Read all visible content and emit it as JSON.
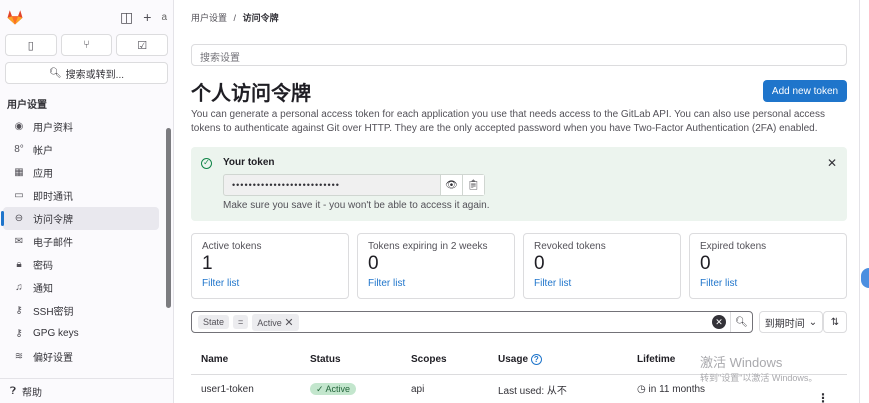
{
  "sidebar": {
    "avatar_alt": "a",
    "search_label": "搜索或转到...",
    "section_title": "用户设置",
    "items": [
      {
        "label": "用户资料",
        "icon": "profile-icon"
      },
      {
        "label": "帐户",
        "icon": "account-icon"
      },
      {
        "label": "应用",
        "icon": "applications-icon"
      },
      {
        "label": "即时通讯",
        "icon": "chat-icon"
      },
      {
        "label": "访问令牌",
        "icon": "token-icon",
        "active": true
      },
      {
        "label": "电子邮件",
        "icon": "mail-icon"
      },
      {
        "label": "密码",
        "icon": "lock-icon"
      },
      {
        "label": "通知",
        "icon": "bell-icon"
      },
      {
        "label": "SSH密钥",
        "icon": "key-icon"
      },
      {
        "label": "GPG keys",
        "icon": "key-icon"
      },
      {
        "label": "偏好设置",
        "icon": "preferences-icon"
      }
    ],
    "help_label": "帮助"
  },
  "breadcrumb": {
    "parent": "用户设置",
    "sep": "/",
    "current": "访问令牌"
  },
  "search_settings_placeholder": "搜索设置",
  "page": {
    "title": "个人访问令牌",
    "add_button": "Add new token",
    "description": "You can generate a personal access token for each application you use that needs access to the GitLab API. You can also use personal access tokens to authenticate against Git over HTTP. They are the only accepted password when you have Two-Factor Authentication (2FA) enabled."
  },
  "alert": {
    "title": "Your token",
    "token_masked": "••••••••••••••••••••••••••",
    "note": "Make sure you save it - you won't be able to access it again."
  },
  "stats": [
    {
      "label": "Active tokens",
      "value": "1",
      "link": "Filter list"
    },
    {
      "label": "Tokens expiring in 2 weeks",
      "value": "0",
      "link": "Filter list"
    },
    {
      "label": "Revoked tokens",
      "value": "0",
      "link": "Filter list"
    },
    {
      "label": "Expired tokens",
      "value": "0",
      "link": "Filter list"
    }
  ],
  "filter": {
    "field": "State",
    "op": "=",
    "value": "Active"
  },
  "sort": {
    "label": "到期时间"
  },
  "table": {
    "headers": [
      "Name",
      "Status",
      "Scopes",
      "Usage",
      "Lifetime"
    ],
    "rows": [
      {
        "name": "user1-token",
        "status": "Active",
        "scopes": "api",
        "usage": "Last used: 从不",
        "lifetime": "in 11 months"
      }
    ]
  },
  "watermark": {
    "line1": "激活 Windows",
    "line2": "转到\"设置\"以激活 Windows。"
  }
}
